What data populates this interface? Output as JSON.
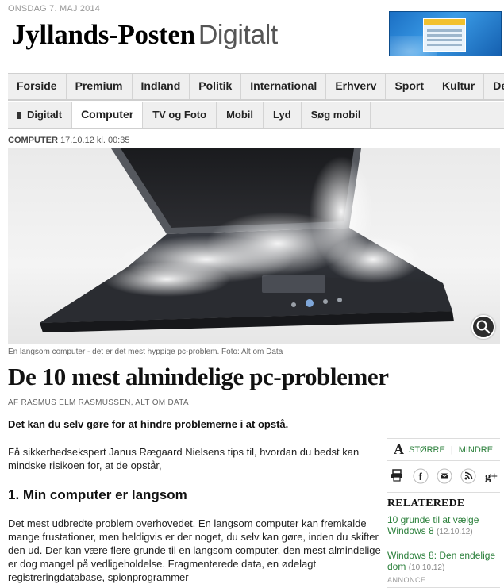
{
  "header": {
    "date": "ONSDAG 7. MAJ 2014",
    "logo_main": "Jyllands-Posten",
    "logo_sub": "Digitalt"
  },
  "nav_main": [
    "Forside",
    "Premium",
    "Indland",
    "Politik",
    "International",
    "Erhverv",
    "Sport",
    "Kultur",
    "Debat"
  ],
  "nav_sub": {
    "section": "Digitalt",
    "items": [
      "Computer",
      "TV og Foto",
      "Mobil",
      "Lyd",
      "Søg mobil"
    ],
    "active": "Computer"
  },
  "article": {
    "section": "COMPUTER",
    "timestamp": "17.10.12 kl. 00:35",
    "caption": "En langsom computer - det er det mest hyppige pc-problem. Foto: Alt om Data",
    "title": "De 10 mest almindelige pc-problemer",
    "byline": "AF RASMUS ELM RASMUSSEN, ALT OM DATA",
    "lead": "Det kan du selv gøre for at hindre problemerne i at opstå.",
    "intro": "Få sikkerhedsekspert Janus Rægaard Nielsens tips til, hvordan du bedst kan mindske risikoen for, at de opstår,",
    "h2": "1. Min computer er langsom",
    "body": "Det mest udbredte problem overhovedet. En langsom computer kan fremkalde mange frustationer, men heldigvis er der noget, du selv kan gøre, inden du skifter den ud. Der kan være flere grunde til en langsom computer, den mest almindelige er dog mangel på vedligeholdelse. Fragmenterede data, en ødelagt registreringdatabase, spionprogrammer"
  },
  "sidebar": {
    "font_glyph": "A",
    "bigger": "STØRRE",
    "smaller": "MINDRE",
    "share_icons": [
      "print-icon",
      "facebook-icon",
      "email-icon",
      "rss-icon",
      "google-plus-icon"
    ],
    "related_heading": "RELATEREDE",
    "related": [
      {
        "title": "10 grunde til at vælge Windows 8",
        "date": "(12.10.12)"
      },
      {
        "title": "Windows 8: Den endelige dom",
        "date": "(10.10.12)"
      }
    ],
    "annonce": "ANNONCE"
  },
  "colors": {
    "link_green": "#2a7f3a",
    "nav_bg": "#efefef"
  }
}
